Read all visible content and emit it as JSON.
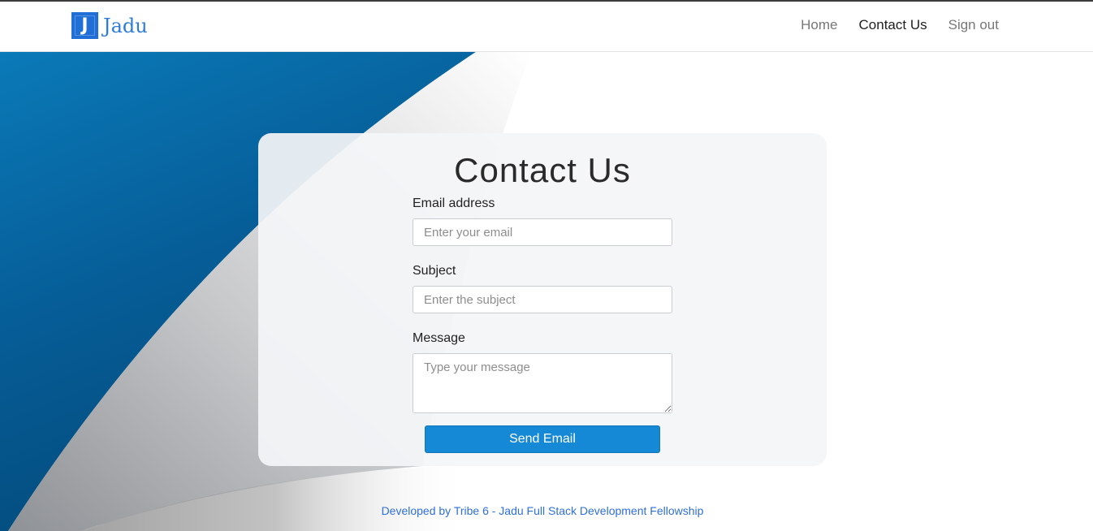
{
  "navbar": {
    "brand_logo_letter": "J",
    "brand_name": "Jadu",
    "links": [
      {
        "label": "Home",
        "active": false
      },
      {
        "label": "Contact Us",
        "active": true
      },
      {
        "label": "Sign out",
        "active": false
      }
    ]
  },
  "contact": {
    "title": "Contact Us",
    "email": {
      "label": "Email address",
      "placeholder": "Enter your email",
      "value": ""
    },
    "subject": {
      "label": "Subject",
      "placeholder": "Enter the subject",
      "value": ""
    },
    "message": {
      "label": "Message",
      "placeholder": "Type your message",
      "value": ""
    },
    "submit_label": "Send Email"
  },
  "footer": {
    "text": "Developed by Tribe 6 - Jadu Full Stack Development Fellowship"
  },
  "colors": {
    "brand": "#1f6fd6",
    "button": "#1589d6",
    "footer_link": "#2f6fd8",
    "background_blue": "#075f9a"
  }
}
